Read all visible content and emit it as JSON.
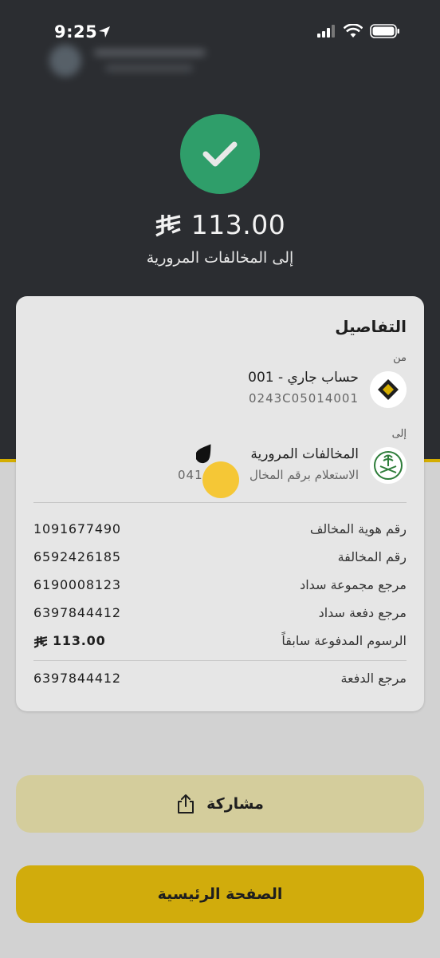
{
  "status_bar": {
    "time": "9:25"
  },
  "header": {
    "amount": "113.00",
    "recipient_label": "إلى المخالفات المرورية",
    "accent_color": "#2f9e6a"
  },
  "details": {
    "title": "التفاصيل",
    "from_label": "من",
    "from_name": "حساب جاري - 001",
    "from_account": "0243C05014001",
    "to_label": "إلى",
    "to_name": "المخالفات المرورية",
    "to_sub_left": "041",
    "to_sub_right": "الاستعلام برقم المخال",
    "rows": [
      {
        "label": "رقم هوية المخالف",
        "value": "1091677490"
      },
      {
        "label": "رقم المخالفة",
        "value": "6592426185"
      },
      {
        "label": "مرجع مجموعة سداد",
        "value": "6190008123"
      },
      {
        "label": "مرجع دفعة سداد",
        "value": "6397844412"
      },
      {
        "label": "الرسوم المدفوعة سابقاً",
        "value": "113.00"
      }
    ],
    "payment_ref_label": "مرجع الدفعة",
    "payment_ref_value": "6397844412"
  },
  "buttons": {
    "share": "مشاركة",
    "home": "الصفحة الرئيسية"
  }
}
